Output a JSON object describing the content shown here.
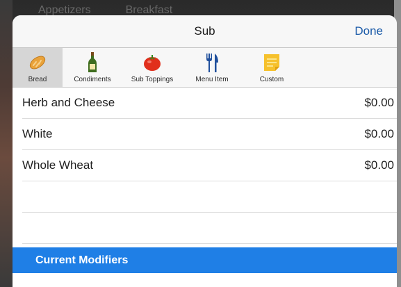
{
  "background": {
    "tabs": [
      "Appetizers",
      "Breakfast"
    ]
  },
  "modal": {
    "title": "Sub",
    "done_label": "Done",
    "tabs": [
      {
        "label": "Bread",
        "icon": "bread-icon",
        "active": true
      },
      {
        "label": "Condiments",
        "icon": "bottle-icon",
        "active": false
      },
      {
        "label": "Sub Toppings",
        "icon": "tomato-icon",
        "active": false
      },
      {
        "label": "Menu Item",
        "icon": "fork-knife-icon",
        "active": false
      },
      {
        "label": "Custom",
        "icon": "note-icon",
        "active": false
      }
    ],
    "items": [
      {
        "name": "Herb and Cheese",
        "price": "$0.00"
      },
      {
        "name": "White",
        "price": "$0.00"
      },
      {
        "name": "Whole Wheat",
        "price": "$0.00"
      }
    ],
    "section_header": "Current Modifiers"
  },
  "colors": {
    "accent": "#1f7fe6",
    "done": "#1a5aa8",
    "active_tab": "#d6d6d6"
  }
}
